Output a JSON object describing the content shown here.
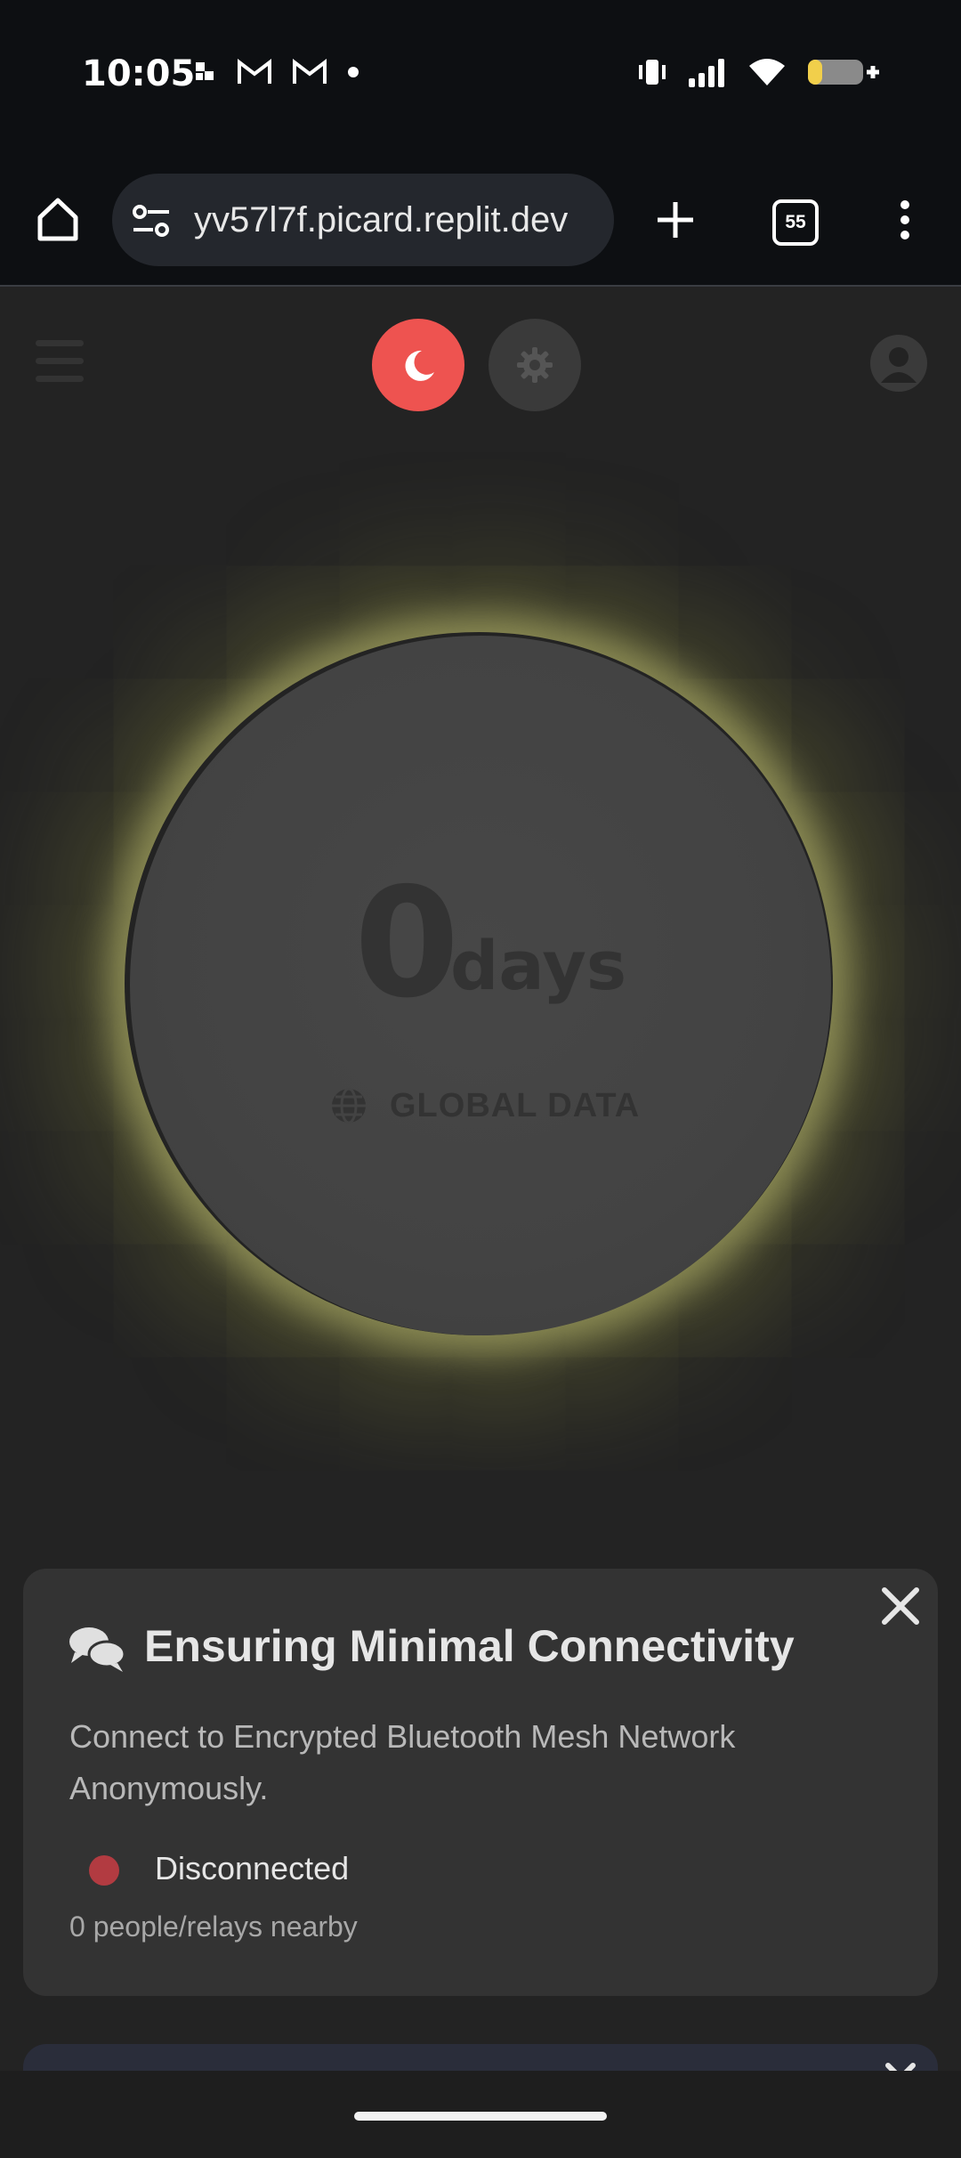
{
  "status_bar": {
    "time": "10:05",
    "left_icons": [
      "notification-icon",
      "gmail-icon",
      "gmail-icon",
      "dot-icon"
    ],
    "right_icons": [
      "vibrate-icon",
      "signal-icon",
      "wifi-icon",
      "battery-icon"
    ]
  },
  "browser": {
    "url": "yv57l7f.picard.replit.dev",
    "tab_count": "55"
  },
  "app_header": {
    "theme_dark_active": true,
    "accent_color": "#ee5350"
  },
  "counter": {
    "value": "0",
    "unit": "days",
    "source_label": "GLOBAL DATA",
    "glow_color": "#a6a66a"
  },
  "connectivity_card": {
    "title": "Ensuring Minimal Connectivity",
    "description": "Connect to Encrypted Bluetooth Mesh Network Anonymously.",
    "status": "Disconnected",
    "status_color": "#b23b41",
    "nearby": "0 people/relays nearby"
  }
}
